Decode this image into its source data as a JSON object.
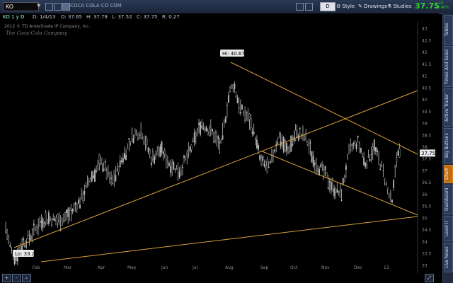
{
  "symbol": "KO",
  "company": "COCA COLA CO COM",
  "toolbar": {
    "d_value": "D",
    "style_label": "Style",
    "drawings_label": "Drawings",
    "studies_label": "Studies",
    "last_price": "37.75",
    "change": "+.19",
    "change_pct": "+0.46%"
  },
  "quote": {
    "label": "KO 1 y D",
    "d": "D: 1/4/13",
    "o": "O: 37.65",
    "h": "H: 37.79",
    "l": "L: 37.52",
    "c": "C: 37.75",
    "r": "R: 0.27"
  },
  "copyright": "2012 © TD Ameritrade IP Company, Inc.",
  "watermark": "The Coca-Cola Company",
  "right_tabs": [
    "Tables",
    "Times And Sales",
    "Active Trader",
    "Big Buttons",
    "Chart",
    "Dashboard",
    "Level II",
    "Live News"
  ],
  "active_tab": "Chart",
  "zoom_plus": "+",
  "zoom_minus": "-",
  "chart_data": {
    "type": "candlestick",
    "ylim": [
      32.8,
      43.2
    ],
    "yticks": [
      "43",
      "42.5",
      "42",
      "41.5",
      "41",
      "40.5",
      "40",
      "39.5",
      "39",
      "38.5",
      "38",
      "37.5",
      "37",
      "36.5",
      "36",
      "35.5",
      "35",
      "34.5",
      "34",
      "33.5",
      "33"
    ],
    "months": [
      "Feb",
      "Mar",
      "Apr",
      "May",
      "Jun",
      "Jul",
      "Aug",
      "Sep",
      "Oct",
      "Nov",
      "Dec",
      "13"
    ],
    "hi_label": "Hi: 40.67",
    "lo_label": "Lo: 33.28",
    "price_label": "37.75",
    "high": 40.67,
    "low": 33.28,
    "last": 37.75,
    "line_color": "#d9a13b",
    "bar_color": "#b8b8b8",
    "label_color": "#e8e8e8"
  }
}
